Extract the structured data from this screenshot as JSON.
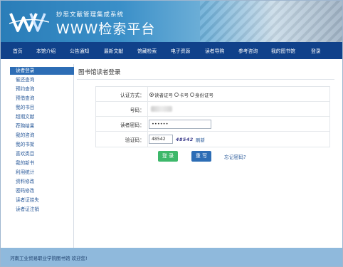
{
  "header": {
    "system_name": "妙思文献管理集成系统",
    "platform_name": "WWW检索平台"
  },
  "nav": {
    "items": [
      "首页",
      "本馆介绍",
      "公告通知",
      "最新文献",
      "馆藏检索",
      "电子资源",
      "读者导购",
      "参考咨询",
      "我的图书馆",
      "登录"
    ]
  },
  "sidebar": {
    "items": [
      "读者登录",
      "催还查询",
      "预约查询",
      "预借查询",
      "我的书目",
      "超期文献",
      "荐购结果",
      "我的咨询",
      "我的书架",
      "喜欢类目",
      "我的新书",
      "利用统计",
      "资料修改",
      "密码修改",
      "读者证挂失",
      "读者证注销"
    ]
  },
  "main": {
    "title": "图书馆读者登录",
    "auth_label": "认证方式：",
    "auth_options": [
      "读者证号",
      "卡号",
      "身份证号"
    ],
    "account_label": "号码：",
    "password_label": "读者密码：",
    "password_value": "••••••",
    "captcha_label": "验证码：",
    "captcha_input": "48542",
    "captcha_image_text": "48542",
    "refresh_label": "刷新",
    "login_button": "登 录",
    "reset_button": "重 写",
    "forgot_link": "忘记密码?"
  },
  "footer": {
    "text": "河南工业贸易职业学院图书馆 欢迎您!"
  },
  "colors": {
    "nav_bg": "#10418a",
    "accent": "#2d6db5",
    "login_btn": "#3db86a",
    "footer_bg": "#8fb9dc"
  }
}
